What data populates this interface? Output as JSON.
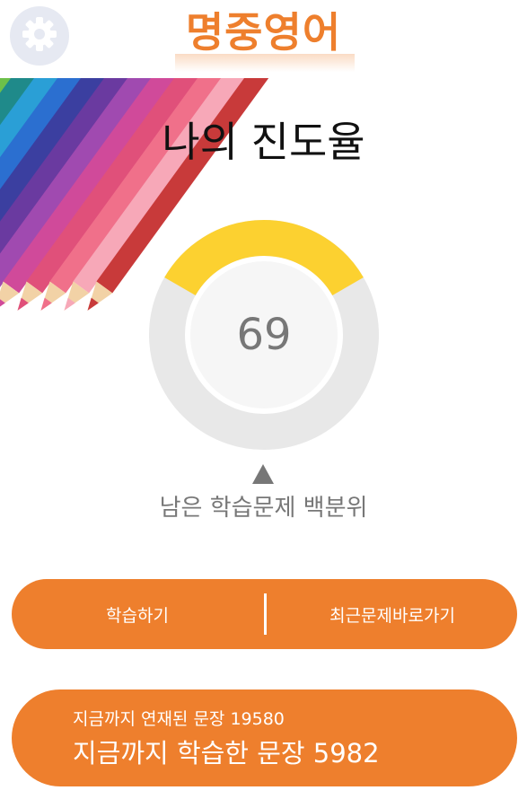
{
  "header": {
    "app_title": "명중영어",
    "settings_icon": "gear-icon"
  },
  "main": {
    "heading": "나의 진도율",
    "progress_value": "69",
    "progress_percent": 69,
    "progress_caption": "남은 학습문제 백분위"
  },
  "actions": {
    "study_label": "학습하기",
    "recent_label": "최근문제바로가기"
  },
  "stats": {
    "serialized_text": "지금까지 연재된 문장 19580",
    "learned_text": "지금까지 학습한 문장 5982"
  },
  "colors": {
    "accent": "#ee7f2d",
    "gauge_fill": "#fcd130",
    "gauge_track": "#e8e8e8",
    "text_muted": "#777777"
  }
}
